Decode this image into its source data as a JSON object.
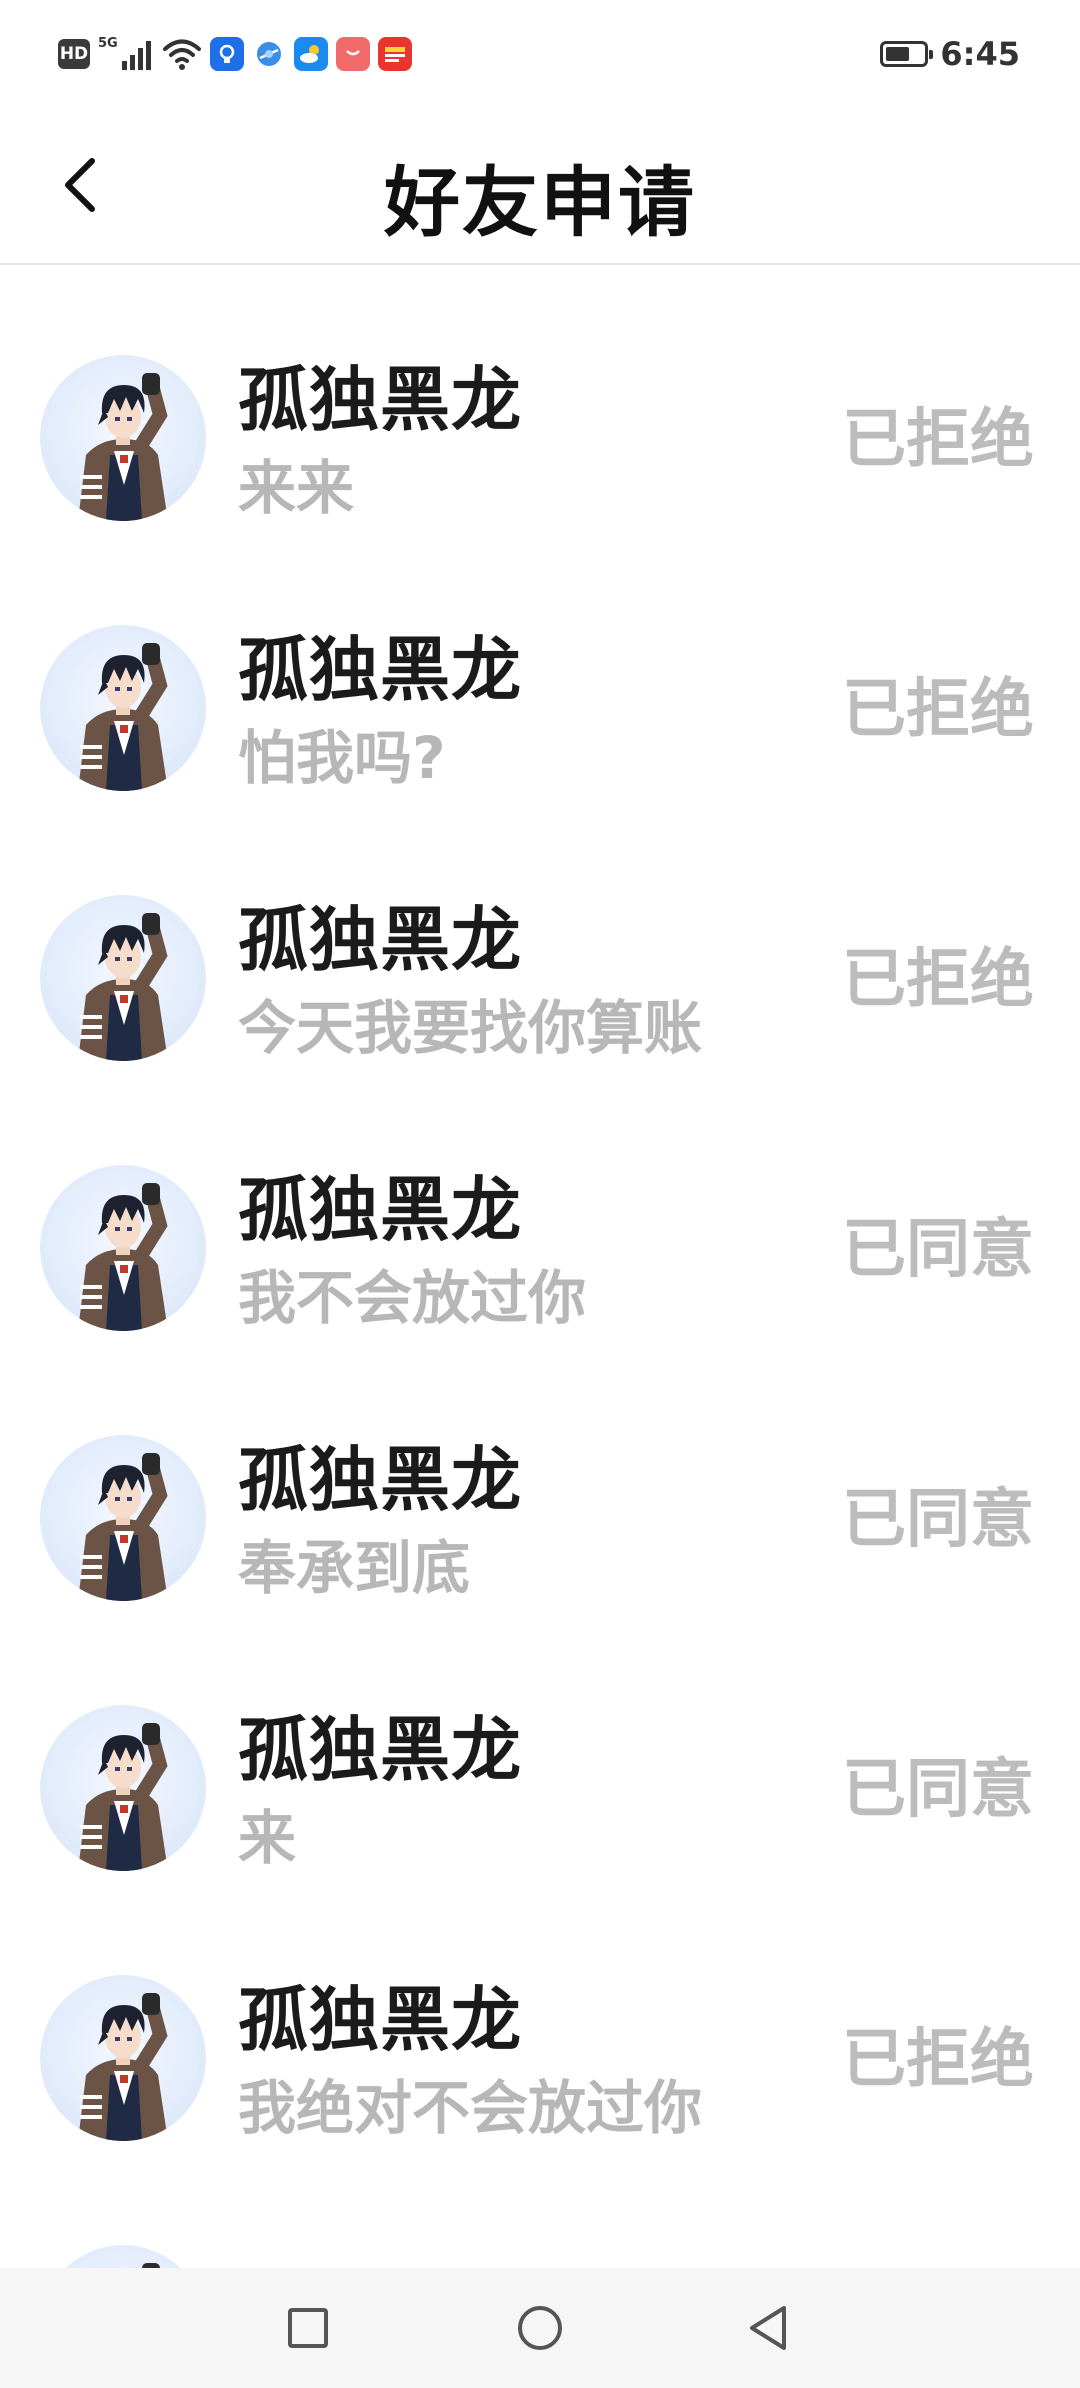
{
  "status_bar": {
    "hd_label": "HD",
    "network_label": "5G",
    "time": "6:45",
    "battery_level": 0.65,
    "icons": [
      "hd-icon",
      "signal-icon",
      "wifi-icon",
      "hint-app-icon",
      "browser-app-icon",
      "weather-app-icon",
      "shopping-app-icon",
      "news-app-icon",
      "battery-icon"
    ]
  },
  "header": {
    "title": "好友申请",
    "back_icon": "chevron-left-icon"
  },
  "requests": [
    {
      "name": "孤独黑龙",
      "message": "来来",
      "status": "已拒绝"
    },
    {
      "name": "孤独黑龙",
      "message": "怕我吗?",
      "status": "已拒绝"
    },
    {
      "name": "孤独黑龙",
      "message": "今天我要找你算账",
      "status": "已拒绝"
    },
    {
      "name": "孤独黑龙",
      "message": "我不会放过你",
      "status": "已同意"
    },
    {
      "name": "孤独黑龙",
      "message": "奉承到底",
      "status": "已同意"
    },
    {
      "name": "孤独黑龙",
      "message": "来",
      "status": "已同意"
    },
    {
      "name": "孤独黑龙",
      "message": "我绝对不会放过你",
      "status": "已拒绝"
    },
    {
      "name": "",
      "message": "",
      "status": ""
    }
  ],
  "nav_bar": {
    "icons": [
      "recent-apps-icon",
      "home-icon",
      "back-triangle-icon"
    ]
  },
  "colors": {
    "name_text": "#1b1b1b",
    "message_text": "#b7b7b7",
    "status_text": "#bcbcbc",
    "divider": "#e6e6e6",
    "nav_bg": "#f6f6f6"
  }
}
